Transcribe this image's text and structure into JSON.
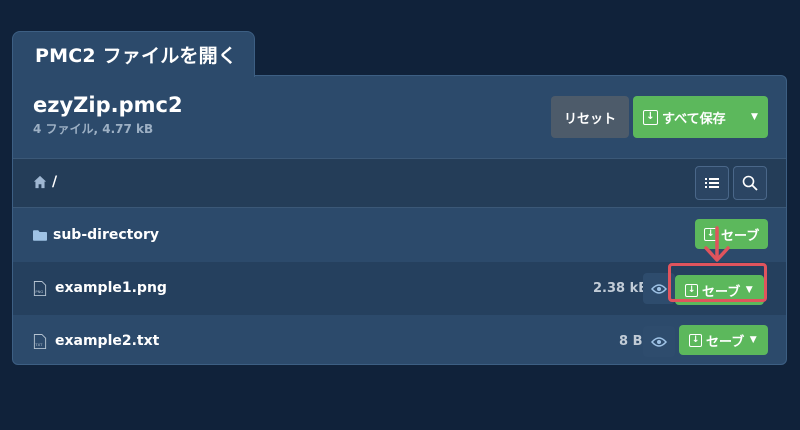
{
  "tab": {
    "title": "PMC2 ファイルを開く"
  },
  "archive": {
    "name": "ezyZip.pmc2",
    "summary": "4 ファイル, 4.77 kB"
  },
  "toolbar": {
    "reset_label": "リセット",
    "save_all_label": "すべて保存"
  },
  "breadcrumb": {
    "path": "/"
  },
  "rows": [
    {
      "name": "sub-directory",
      "type": "folder",
      "size": "",
      "save_label": "セーブ"
    },
    {
      "name": "example1.png",
      "type": "file",
      "file_badge": "PNG",
      "size": "2.38 kB",
      "save_label": "セーブ",
      "highlighted": true
    },
    {
      "name": "example2.txt",
      "type": "file",
      "file_badge": "TXT",
      "size": "8 B",
      "save_label": "セーブ"
    }
  ],
  "colors": {
    "background": "#10223a",
    "panel": "#2c4a6b",
    "accent_green": "#5cb85c",
    "highlight_red": "#e0545d",
    "reset_gray": "#4d5b6a"
  },
  "icons": [
    "home-icon",
    "list-view-icon",
    "search-icon",
    "folder-icon",
    "file-icon",
    "eye-icon",
    "download-icon",
    "caret-down-icon",
    "arrow-down-icon"
  ]
}
